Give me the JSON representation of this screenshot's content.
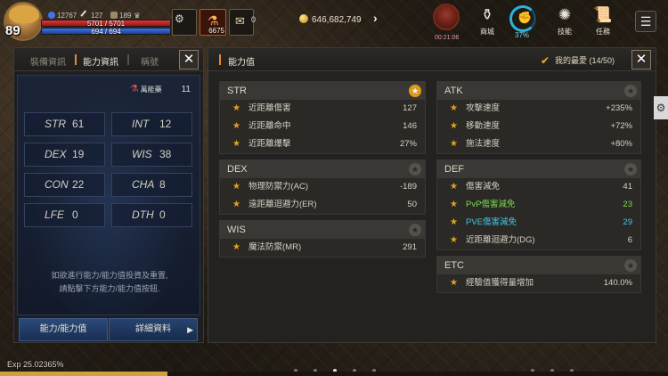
{
  "hud": {
    "level": "89",
    "stat_a": "12767",
    "stat_b": "127",
    "stat_c": "189",
    "hp_text": "5701 / 5701",
    "mp_text": "694 / 694",
    "hp_fraction": 1.0,
    "mp_fraction": 1.0,
    "potion_count": "6675",
    "scroll_count": "0",
    "gold": "646,682,749",
    "boss_timer": "00:21:06",
    "shop_label": "商城",
    "auto_percent": "37%",
    "skill_label": "技能",
    "quest_label": "任務"
  },
  "left_panel": {
    "tabs": [
      "裝備資訊",
      "能力資訊",
      "稱號"
    ],
    "active_tab": 1,
    "potion_label": "萬能藥",
    "potion_value": "11",
    "attributes": [
      {
        "key": "STR",
        "value": "61"
      },
      {
        "key": "INT",
        "value": "12"
      },
      {
        "key": "DEX",
        "value": "19"
      },
      {
        "key": "WIS",
        "value": "38"
      },
      {
        "key": "CON",
        "value": "22"
      },
      {
        "key": "CHA",
        "value": "8"
      },
      {
        "key": "LFE",
        "value": "0"
      },
      {
        "key": "DTH",
        "value": "0"
      }
    ],
    "hint_line1": "如欲進行能力/能力值投資及重置,",
    "hint_line2": "請點擊下方能力/能力值按鈕.",
    "button_ability": "能力/能力值",
    "button_detail": "詳細資料"
  },
  "right_panel": {
    "title": "能力值",
    "favorites_label": "我的最愛 (14/50)",
    "groups": {
      "str": {
        "title": "STR",
        "starred": true,
        "rows": [
          {
            "name": "近距離傷害",
            "value": "127"
          },
          {
            "name": "近距離命中",
            "value": "146"
          },
          {
            "name": "近距離爆擊",
            "value": "27%"
          }
        ]
      },
      "dex": {
        "title": "DEX",
        "starred": false,
        "rows": [
          {
            "name": "物理防禦力(AC)",
            "value": "-189"
          },
          {
            "name": "遠距離迴避力(ER)",
            "value": "50"
          }
        ]
      },
      "wis": {
        "title": "WIS",
        "starred": false,
        "rows": [
          {
            "name": "魔法防禦(MR)",
            "value": "291"
          }
        ]
      },
      "atk": {
        "title": "ATK",
        "starred": false,
        "rows": [
          {
            "name": "攻擊速度",
            "value": "+235%"
          },
          {
            "name": "移動速度",
            "value": "+72%"
          },
          {
            "name": "施法速度",
            "value": "+80%"
          }
        ]
      },
      "def": {
        "title": "DEF",
        "starred": false,
        "rows": [
          {
            "name": "傷害減免",
            "value": "41"
          },
          {
            "name": "PvP傷害減免",
            "value": "23"
          },
          {
            "name": "PVE傷害減免",
            "value": "29"
          },
          {
            "name": "近距離迴避力(DG)",
            "value": "6"
          }
        ]
      },
      "etc": {
        "title": "ETC",
        "starred": false,
        "rows": [
          {
            "name": "經驗值獲得量增加",
            "value": "140.0%"
          }
        ]
      }
    }
  },
  "bottom": {
    "exp_text": "Exp 25.02365%",
    "exp_fraction": 0.2502365
  },
  "colors": {
    "accent_orange": "#e08d2e",
    "star_gold": "#e3a21f",
    "pvp_green": "#7dd94d",
    "pve_cyan": "#43c6e8",
    "hp_red": "#e23636",
    "mp_blue": "#3f75e8"
  },
  "icons": [
    "avatar",
    "gear-icon",
    "potion-icon",
    "scroll-icon",
    "coin-icon",
    "chevron-right-icon",
    "boss-icon",
    "shop-icon",
    "auto-icon",
    "skill-icon",
    "quest-icon",
    "menu-icon",
    "close-icon",
    "star-icon",
    "checkbox-icon"
  ]
}
